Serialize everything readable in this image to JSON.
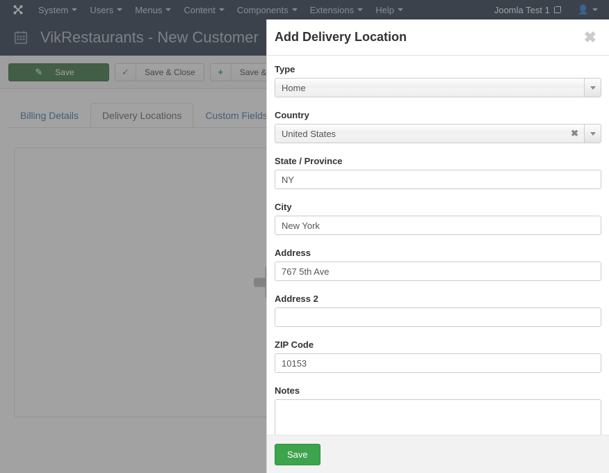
{
  "topnav": {
    "logo_icon": "joomla-logo-icon",
    "items": [
      {
        "label": "System"
      },
      {
        "label": "Users"
      },
      {
        "label": "Menus"
      },
      {
        "label": "Content"
      },
      {
        "label": "Components"
      },
      {
        "label": "Extensions"
      },
      {
        "label": "Help"
      }
    ],
    "site_name": "Joomla Test 1",
    "site_link_icon": "external-link-icon",
    "account_icon": "user-icon",
    "account_caret_icon": "chevron-down-icon"
  },
  "page": {
    "icon": "calendar-icon",
    "title": "VikRestaurants - New Customer"
  },
  "toolbar": {
    "buttons": [
      {
        "label": "Save",
        "icon": "edit-square-icon",
        "style": "primary"
      },
      {
        "label": "Save & Close",
        "icon": "check-icon",
        "style": "default"
      },
      {
        "label": "Save & N",
        "icon": "plus-icon",
        "style": "default"
      }
    ]
  },
  "tabs": [
    {
      "label": "Billing Details",
      "active": false
    },
    {
      "label": "Delivery Locations",
      "active": true
    },
    {
      "label": "Custom Fields",
      "active": false
    }
  ],
  "content": {
    "add_placeholder_icon": "plus-icon"
  },
  "modal": {
    "title": "Add Delivery Location",
    "close_icon": "close-icon",
    "fields": {
      "type": {
        "label": "Type",
        "value": "Home",
        "arrow_icon": "chevron-down-icon"
      },
      "country": {
        "label": "Country",
        "value": "United States",
        "clear_icon": "clear-x-icon",
        "arrow_icon": "chevron-down-icon"
      },
      "state": {
        "label": "State / Province",
        "value": "NY",
        "placeholder": ""
      },
      "city": {
        "label": "City",
        "value": "New York",
        "placeholder": ""
      },
      "address": {
        "label": "Address",
        "value": "767 5th Ave",
        "placeholder": ""
      },
      "address2": {
        "label": "Address 2",
        "value": "",
        "placeholder": ""
      },
      "zip": {
        "label": "ZIP Code",
        "value": "10153",
        "placeholder": ""
      },
      "notes": {
        "label": "Notes",
        "value": "",
        "placeholder": ""
      }
    },
    "save_label": "Save"
  },
  "colors": {
    "navy": "#1c2a42",
    "primary_green": "#2c6a33",
    "modal_save_green": "#3da34d",
    "tab_link": "#31689b"
  }
}
